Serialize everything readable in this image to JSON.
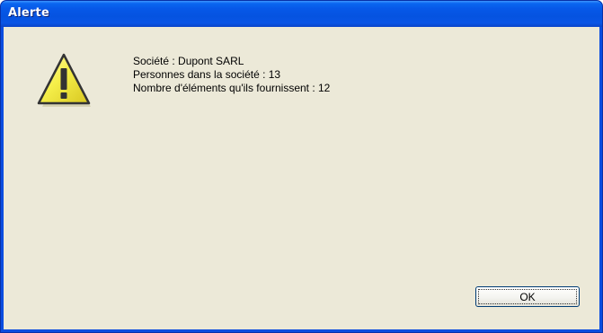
{
  "window": {
    "title": "Alerte"
  },
  "dialog": {
    "icon": "warning-icon",
    "lines": [
      "Société : Dupont SARL",
      "Personnes dans la société : 13",
      "Nombre d'éléments qu'ils fournissent : 12"
    ],
    "ok_label": "OK"
  },
  "colors": {
    "titlebar": "#0553e0",
    "client_background": "#ece9d8",
    "warning_fill": "#f5ef4a"
  }
}
